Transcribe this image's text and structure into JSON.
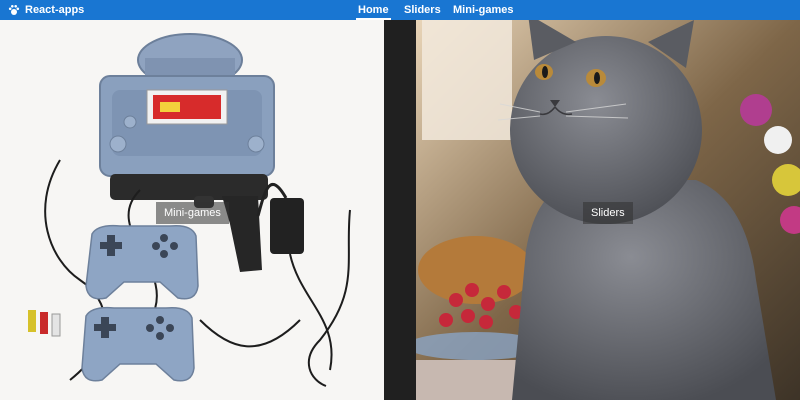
{
  "header": {
    "app_title": "React-apps",
    "app_icon": "paw-icon",
    "accent": "#1976d2"
  },
  "nav": {
    "items": [
      "Home",
      "Sliders",
      "Mini-games"
    ],
    "active": "Home"
  },
  "tiles": {
    "mini_games": {
      "label": "Mini-games"
    },
    "sliders": {
      "label": "Sliders"
    }
  }
}
